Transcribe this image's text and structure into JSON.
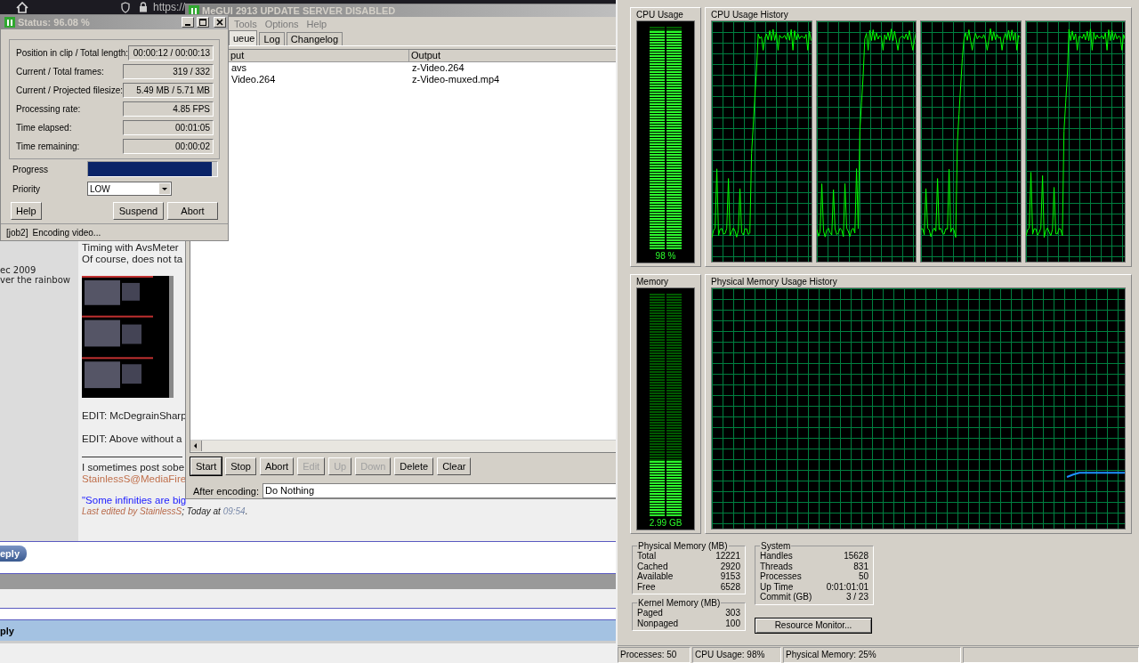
{
  "browser": {
    "address": "https://"
  },
  "forum": {
    "sidebar_lines": [
      "ec 2009",
      "ver the rainbow"
    ],
    "intro_lines": [
      "Timing with AvsMeter",
      "Of course, does not ta"
    ],
    "edit_lines": [
      "EDIT: McDegrainSharp",
      "EDIT: Above without a"
    ],
    "signature": "I sometimes post sobe",
    "signature_link": "StainlessS@MediaFire",
    "quote": "\"Some infinities are big",
    "edit_note": {
      "author": "Last edited by StainlessS",
      "middle": "; Today at",
      "time": "09:54",
      "end": "."
    },
    "reply_button": "eply",
    "quick_reply_title": "ply"
  },
  "megui": {
    "title": "MeGUI 2913 UPDATE SERVER DISABLED",
    "menu": [
      "Tools",
      "Options",
      "Help"
    ],
    "tabs": [
      {
        "label": "ueue",
        "selected": true
      },
      {
        "label": "Log",
        "selected": false
      },
      {
        "label": "Changelog",
        "selected": false
      }
    ],
    "columns": [
      "put",
      "Output"
    ],
    "rows": [
      [
        "avs",
        "z-Video.264"
      ],
      [
        "Video.264",
        "z-Video-muxed.mp4"
      ]
    ],
    "buttons": [
      {
        "label": "Start",
        "disabled": false,
        "default": true
      },
      {
        "label": "Stop",
        "disabled": false,
        "default": false
      },
      {
        "label": "Abort",
        "disabled": false,
        "default": false
      },
      {
        "label": "Edit",
        "disabled": true,
        "default": false
      },
      {
        "label": "Up",
        "disabled": true,
        "default": false
      },
      {
        "label": "Down",
        "disabled": true,
        "default": false
      },
      {
        "label": "Delete",
        "disabled": false,
        "default": false
      },
      {
        "label": "Clear",
        "disabled": false,
        "default": false
      }
    ],
    "after_encoding": {
      "label": "After encoding:",
      "value": "Do Nothing"
    }
  },
  "status_window": {
    "title": "Status: 96.08 %",
    "fields": [
      {
        "label": "Position in clip / Total length:",
        "value": "00:00:12 / 00:00:13"
      },
      {
        "label": "Current / Total frames:",
        "value": "319 / 332"
      },
      {
        "label": "Current / Projected filesize:",
        "value": "5.49 MB / 5.71 MB"
      },
      {
        "label": "Processing rate:",
        "value": "4.85 FPS"
      },
      {
        "label": "Time elapsed:",
        "value": "00:01:05"
      },
      {
        "label": "Time remaining:",
        "value": "00:00:02"
      }
    ],
    "progress": {
      "label": "Progress",
      "level": 0.96
    },
    "priority": {
      "label": "Priority",
      "value": "LOW"
    },
    "buttons": [
      "Help",
      "Suspend",
      "Abort"
    ],
    "status_bar": [
      "[job2]",
      "Encoding video..."
    ]
  },
  "task_manager": {
    "cpu_usage": {
      "title": "CPU Usage",
      "level": 0.98,
      "reading": "98 %"
    },
    "cpu_history": {
      "title": "CPU Usage History"
    },
    "memory": {
      "title": "Memory",
      "level": 0.25,
      "reading": "2.99 GB"
    },
    "memory_history": {
      "title": "Physical Memory Usage History"
    },
    "physical_memory": {
      "title": "Physical Memory (MB)",
      "rows": [
        {
          "label": "Total",
          "value": "12221"
        },
        {
          "label": "Cached",
          "value": "2920"
        },
        {
          "label": "Available",
          "value": "9153"
        },
        {
          "label": "Free",
          "value": "6528"
        }
      ]
    },
    "kernel_memory": {
      "title": "Kernel Memory (MB)",
      "rows": [
        {
          "label": "Paged",
          "value": "303"
        },
        {
          "label": "Nonpaged",
          "value": "100"
        }
      ]
    },
    "system": {
      "title": "System",
      "rows": [
        {
          "label": "Handles",
          "value": "15628"
        },
        {
          "label": "Threads",
          "value": "831"
        },
        {
          "label": "Processes",
          "value": "50"
        },
        {
          "label": "Up Time",
          "value": "0:01:01:01"
        },
        {
          "label": "Commit (GB)",
          "value": "3 / 23"
        }
      ]
    },
    "resource_monitor_button": "Resource Monitor...",
    "status_bar": [
      "Processes: 50",
      "CPU Usage: 98%",
      "Physical Memory: 25%"
    ]
  }
}
